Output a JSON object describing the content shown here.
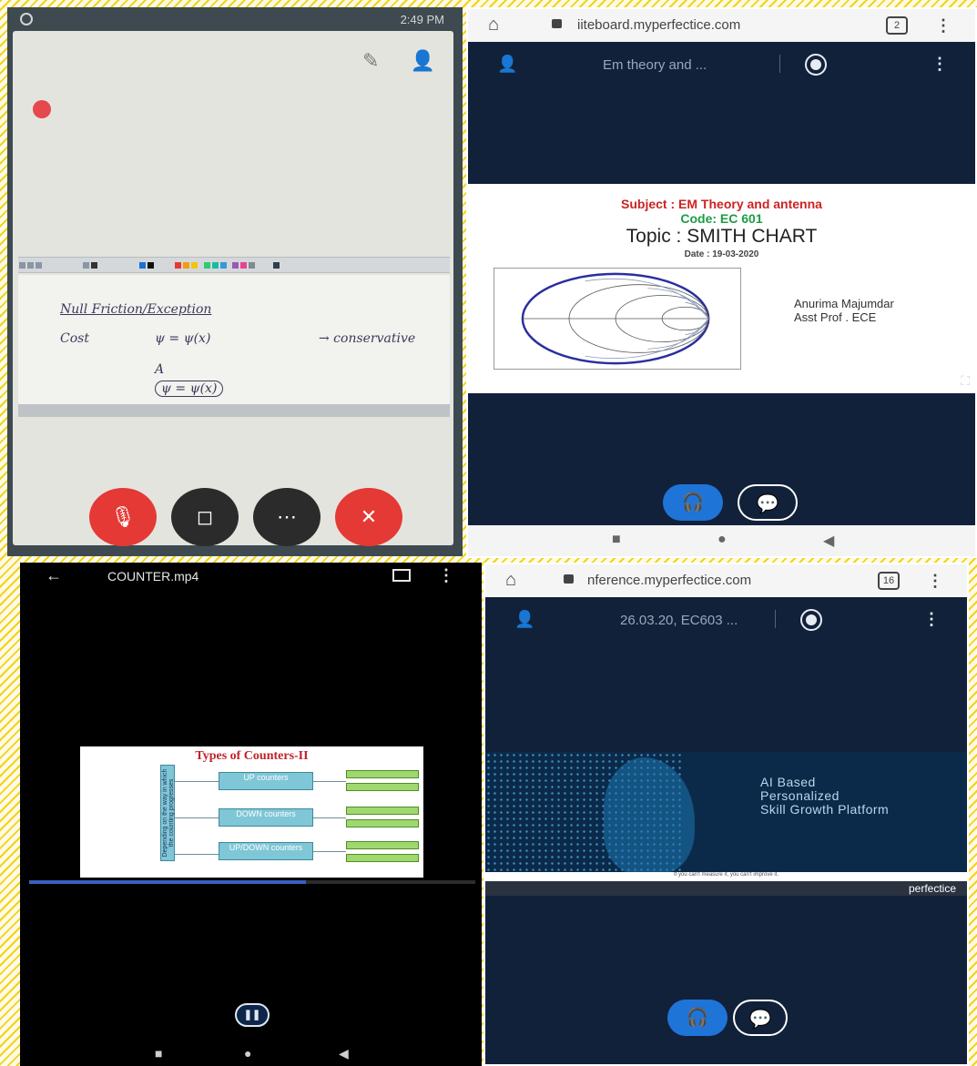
{
  "whiteboard_photo": {
    "status_time": "2:49 PM",
    "handwriting": [
      "Null Friction/Exception",
      "Cost",
      "ψ = ψ(x)",
      "A",
      "ψ = ψ(x)",
      "→ conservative"
    ]
  },
  "smith_session": {
    "url": "iiteboard.myperfectice.com",
    "tab_count": "2",
    "meeting_title": "Em theory and ...",
    "slide": {
      "subject": "Subject : EM Theory and antenna",
      "code": "Code: EC 601",
      "topic": "Topic : SMITH CHART",
      "date": "Date : 19-03-2020",
      "author_name": "Anurima Majumdar",
      "author_title": "Asst Prof . ECE"
    }
  },
  "video_player": {
    "file_name": "COUNTER.mp4",
    "progress": 0.62,
    "slide": {
      "title": "Types of Counters-II",
      "side_label": "Depending on the way in which the counting progresses",
      "counters": [
        "UP counters",
        "DOWN counters",
        "UP/DOWN counters"
      ]
    }
  },
  "ai_session": {
    "url": "nference.myperfectice.com",
    "tab_count": "16",
    "meeting_title": "26.03.20, EC603 ...",
    "slide_text": [
      "AI Based",
      "Personalized",
      "Skill Growth Platform"
    ],
    "caption": "If you can't measure it, you can't improve it.",
    "brand": "perfectice"
  },
  "colors": {
    "app_navy": "#12213a",
    "audio_blue": "#1f74d8",
    "subject_red": "#cc2323",
    "code_green": "#1e9c45",
    "end_call_red": "#e53935"
  }
}
